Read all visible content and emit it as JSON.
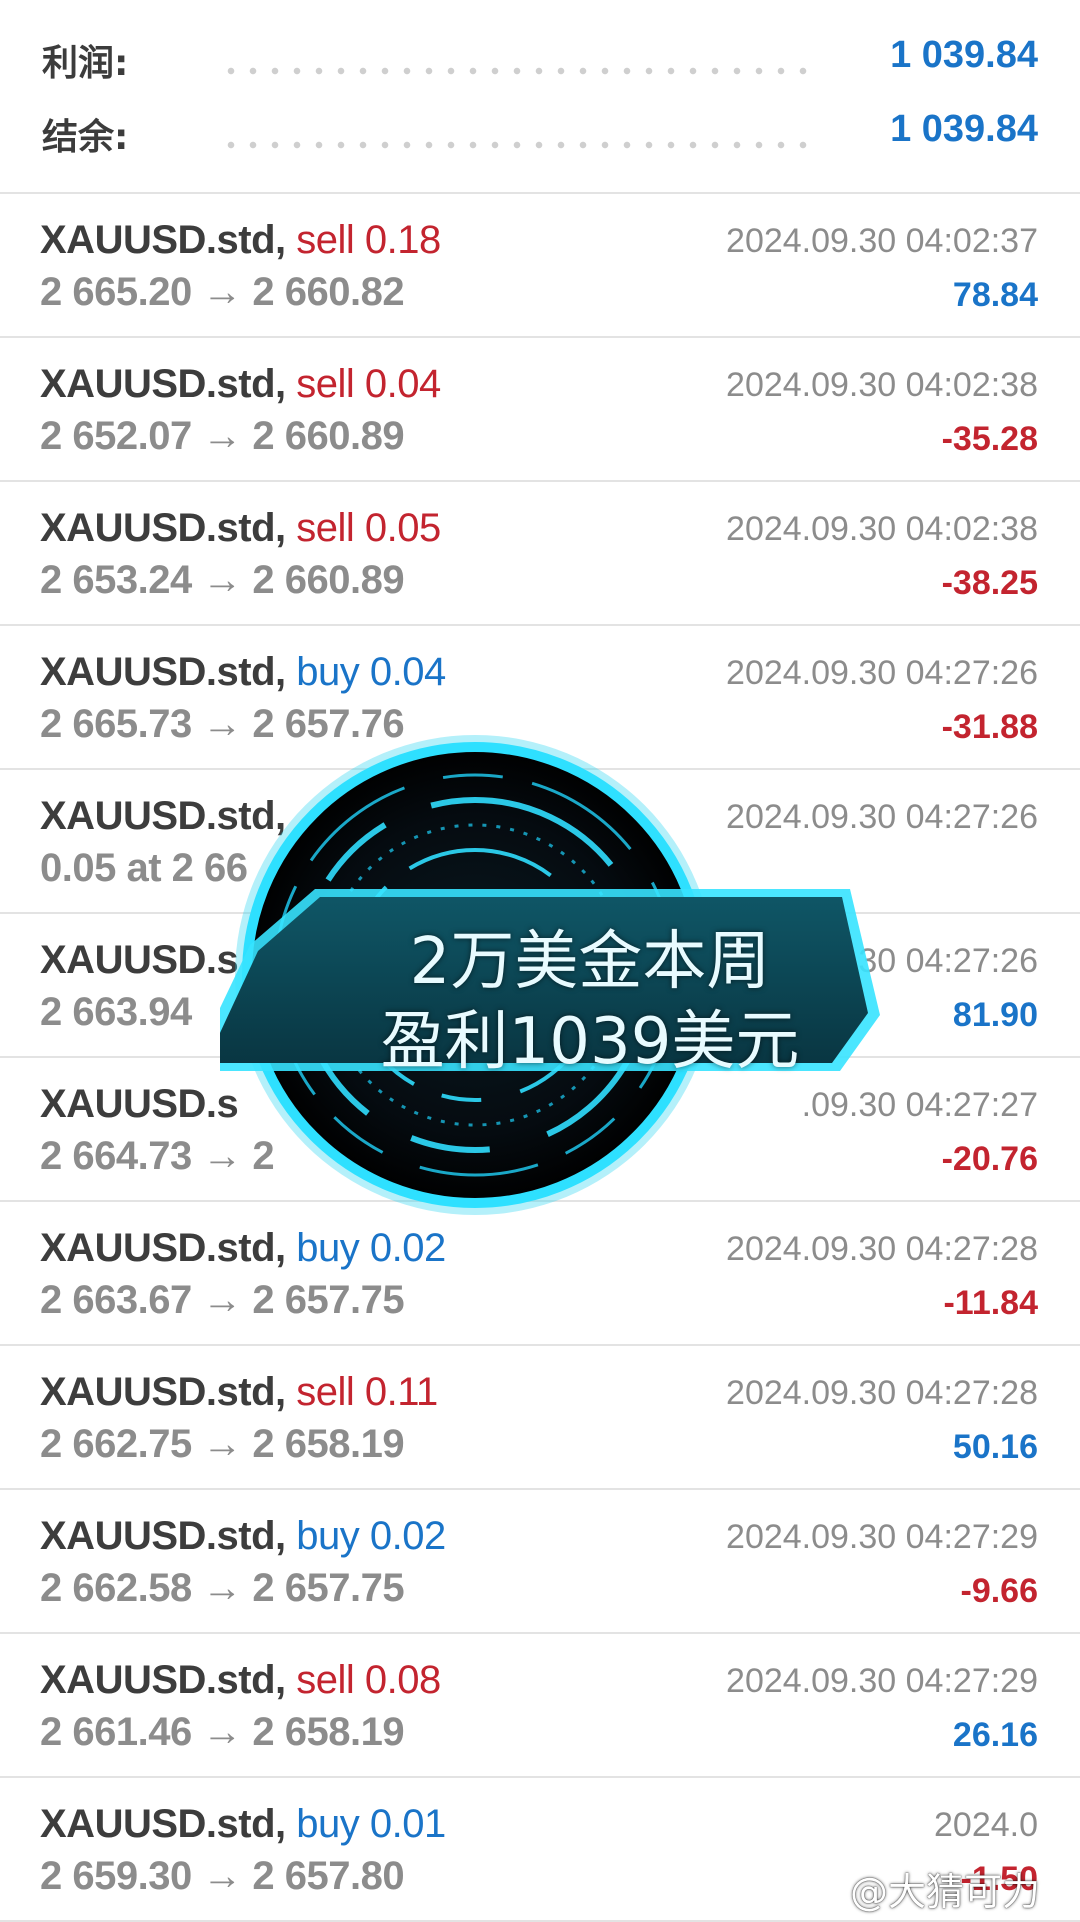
{
  "summary": {
    "profit_label": "利润:",
    "profit_value": "1 039.84",
    "balance_label": "结余:",
    "balance_value": "1 039.84"
  },
  "deals": [
    {
      "symbol": "XAUUSD.std,",
      "type": "sell",
      "volume": "0.18",
      "prices": "2 665.20 → 2 660.82",
      "time": "2024.09.30 04:02:37",
      "profit": "78.84"
    },
    {
      "symbol": "XAUUSD.std,",
      "type": "sell",
      "volume": "0.04",
      "prices": "2 652.07 → 2 660.89",
      "time": "2024.09.30 04:02:38",
      "profit": "-35.28"
    },
    {
      "symbol": "XAUUSD.std,",
      "type": "sell",
      "volume": "0.05",
      "prices": "2 653.24 → 2 660.89",
      "time": "2024.09.30 04:02:38",
      "profit": "-38.25"
    },
    {
      "symbol": "XAUUSD.std,",
      "type": "buy",
      "volume": "0.04",
      "prices": "2 665.73 → 2 657.76",
      "time": "2024.09.30 04:27:26",
      "profit": "-31.88"
    },
    {
      "symbol": "XAUUSD.std,",
      "type": "",
      "volume": "",
      "prices": "0.05 at 2 66",
      "time": "2024.09.30 04:27:26",
      "profit": ""
    },
    {
      "symbol": "XAUUSD.s",
      "type": "",
      "volume": "",
      "prices": "2 663.94",
      "time": ".30 04:27:26",
      "profit": "81.90"
    },
    {
      "symbol": "XAUUSD.s",
      "type": "",
      "volume": "",
      "prices": "2 664.73 → 2",
      "time": ".09.30 04:27:27",
      "profit": "-20.76"
    },
    {
      "symbol": "XAUUSD.std,",
      "type": "buy",
      "volume": "0.02",
      "prices": "2 663.67 → 2 657.75",
      "time": "2024.09.30 04:27:28",
      "profit": "-11.84"
    },
    {
      "symbol": "XAUUSD.std,",
      "type": "sell",
      "volume": "0.11",
      "prices": "2 662.75 → 2 658.19",
      "time": "2024.09.30 04:27:28",
      "profit": "50.16"
    },
    {
      "symbol": "XAUUSD.std,",
      "type": "buy",
      "volume": "0.02",
      "prices": "2 662.58 → 2 657.75",
      "time": "2024.09.30 04:27:29",
      "profit": "-9.66"
    },
    {
      "symbol": "XAUUSD.std,",
      "type": "sell",
      "volume": "0.08",
      "prices": "2 661.46 → 2 658.19",
      "time": "2024.09.30 04:27:29",
      "profit": "26.16"
    },
    {
      "symbol": "XAUUSD.std,",
      "type": "buy",
      "volume": "0.01",
      "prices": "2 659.30 → 2 657.80",
      "time": "2024.0",
      "profit": "-1.50"
    }
  ],
  "overlay": {
    "line1": "2万美金本周",
    "line2": "盈利1039美元"
  },
  "watermark": "@大猜可力"
}
